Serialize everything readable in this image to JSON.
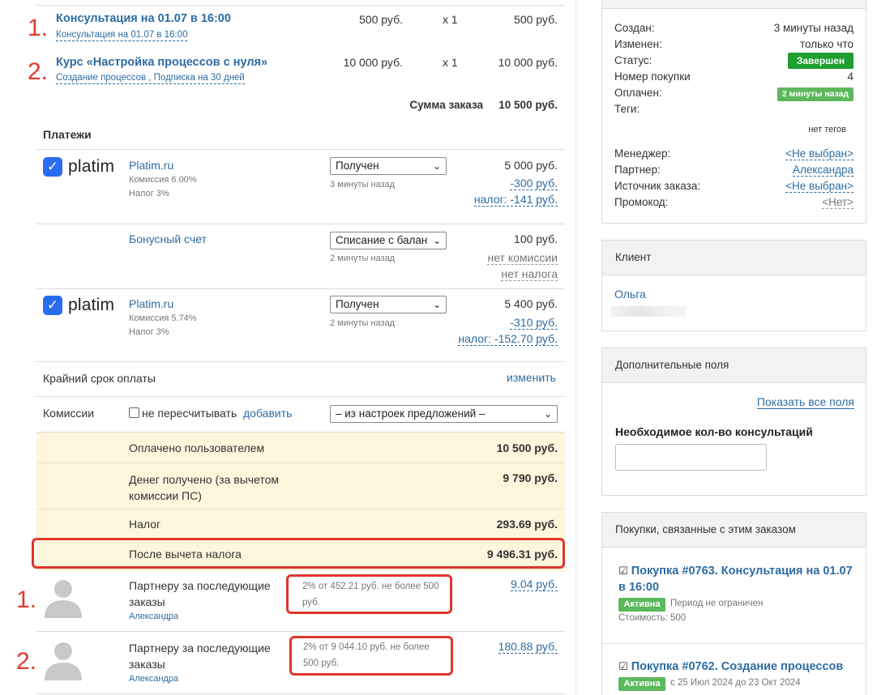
{
  "items": [
    {
      "num": "1.",
      "title": "Консультация на 01.07 в 16:00",
      "sub": "Консультация на 01.07 в 16:00",
      "price": "500 руб.",
      "qty": "x 1",
      "total": "500 руб."
    },
    {
      "num": "2.",
      "title": "Курс «Настройка процессов с нуля»",
      "sub": "Создание процессов , Подписка на 30 дней",
      "price": "10 000 руб.",
      "qty": "x 1",
      "total": "10 000 руб."
    }
  ],
  "order_sum": {
    "label": "Сумма заказа",
    "value": "10 500 руб."
  },
  "payments": {
    "title": "Платежи",
    "logo_text": "platim",
    "rows": [
      {
        "name": "Platim.ru",
        "fee": "Комиссия 6.00%",
        "tax": "Налог 3%",
        "status": "Получен",
        "time": "3 минуты назад",
        "amount": "5 000 руб.",
        "fee_amount": "-300 руб.",
        "tax_amount": "налог: -141 руб."
      },
      {
        "name": "Бонусный счет",
        "status": "Списание с балан",
        "time": "2 минуты назад",
        "amount": "100 руб.",
        "fee_amount": "нет комиссии",
        "tax_amount": "нет налога"
      },
      {
        "name": "Platim.ru",
        "fee": "Комиссия 5.74%",
        "tax": "Налог 3%",
        "status": "Получен",
        "time": "2 минуты назад",
        "amount": "5 400 руб.",
        "fee_amount": "-310 руб.",
        "tax_amount": "налог: -152.70 руб."
      }
    ]
  },
  "deadline": {
    "label": "Крайний срок оплаты",
    "link": "изменить"
  },
  "commissions": {
    "label": "Комиссии",
    "checkbox_label": "не пересчитывать",
    "add_link": "добавить",
    "select": "– из настроек предложений –"
  },
  "summary": [
    {
      "label": "Оплачено пользователем",
      "value": "10 500 руб."
    },
    {
      "label": "Денег получено (за вычетом комиссии ПС)",
      "value": "9 790 руб."
    },
    {
      "label": "Налог",
      "value": "293.69 руб."
    },
    {
      "label": "После вычета налога",
      "value": "9 496.31 руб."
    }
  ],
  "partners": [
    {
      "num": "1.",
      "label": "Партнеру за последующие заказы",
      "name": "Александра",
      "calc": "2% от 452.21 руб. не более 500 руб.",
      "value": "9.04 руб."
    },
    {
      "num": "2.",
      "label": "Партнеру за последующие заказы",
      "name": "Александра",
      "calc": "2% от 9 044.10 руб. не более 500 руб.",
      "value": "180.88 руб."
    }
  ],
  "info": {
    "created_label": "Создан:",
    "created": "3 минуты назад",
    "changed_label": "Изменен:",
    "changed": "только что",
    "status_label": "Статус:",
    "status": "Завершен",
    "number_label": "Номер покупки",
    "number": "4",
    "paid_label": "Оплачен:",
    "paid": "2 минуты назад",
    "tags_label": "Теги:",
    "tags": "нет тегов",
    "manager_label": "Менеджер:",
    "manager": "<Не выбран>",
    "partner_label": "Партнер:",
    "partner": "Александра",
    "source_label": "Источник заказа:",
    "source": "<Не выбран>",
    "promo_label": "Промокод:",
    "promo": "<Нет>"
  },
  "client": {
    "title": "Клиент",
    "name": "Ольга"
  },
  "extra": {
    "title": "Дополнительные поля",
    "show_all": "Показать все поля",
    "field_label": "Необходимое кол-во консультаций",
    "field_value": ""
  },
  "related": {
    "title": "Покупки, связанные с этим заказом",
    "items": [
      {
        "link": "Покупка #0763. Консультация на 01.07 в 16:00",
        "badge": "Активна",
        "period": "Период не ограничен",
        "cost": "Стоимость: 500"
      },
      {
        "link": "Покупка #0762. Создание процессов",
        "badge": "Активна",
        "period": "с 25 Июл 2024 до 23 Окт 2024"
      }
    ]
  },
  "colors": {
    "accent": "#2d6ca2",
    "success": "#1e9e2f",
    "badge": "#5cb85c",
    "highlight": "#e0352b",
    "summary_bg": "#fdf5dc"
  }
}
